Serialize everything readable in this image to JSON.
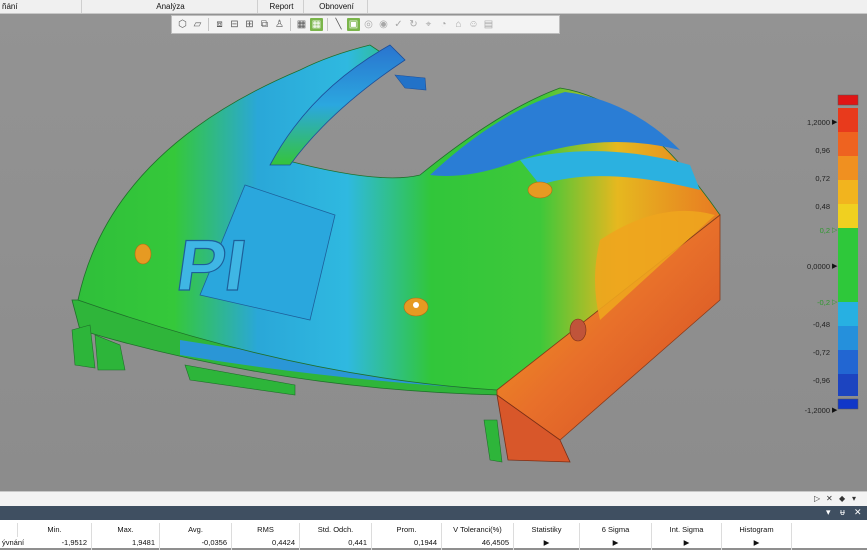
{
  "menubar": {
    "items": [
      "ñání",
      "Analýza",
      "Report",
      "Obnovení"
    ]
  },
  "toolbar": {
    "icons": [
      "sphere-icon",
      "cube-icon",
      "cube-box-icon",
      "front-view-icon",
      "side-view-icon",
      "copy-view-icon",
      "figure-icon",
      "grid-icon",
      "grid-active-icon",
      "line-tool-icon",
      "plane-fill-icon",
      "target-icon",
      "circle-target-icon",
      "checkmark-icon",
      "rotate-icon",
      "measure-icon",
      "gauge-icon",
      "section-icon",
      "person-icon",
      "ruler-icon"
    ]
  },
  "color_scale": {
    "labels": [
      "1,2000",
      "0,96",
      "0,72",
      "0,48",
      "0,2",
      "0,0000",
      "-0,2",
      "-0,48",
      "-0,72",
      "-0,96",
      "-1,2000"
    ],
    "colors": [
      "#1037c8",
      "#1f63d6",
      "#2588de",
      "#27a7e2",
      "#2ec24f",
      "#32c832",
      "#e8c020",
      "#f0a010",
      "#ee7020",
      "#e84e20",
      "#d62020"
    ]
  },
  "panel": {
    "strip_controls": [
      "▷",
      "✕",
      "◆",
      "▾"
    ],
    "bar_controls": [
      "▾",
      "ᵾ",
      "✕"
    ]
  },
  "results": {
    "columns": [
      "Min.",
      "Max.",
      "Avg.",
      "RMS",
      "Std. Odch.",
      "Prom.",
      "V Toleranci(%)",
      "Statistiky",
      "6 Sigma",
      "Int. Sigma",
      "Histogram"
    ],
    "row_label": "ývnání",
    "row_values": [
      "-1,9512",
      "1,9481",
      "-0,0356",
      "0,4424",
      "0,441",
      "0,1944",
      "46,4505",
      "▶",
      "▶",
      "▶",
      "▶"
    ]
  }
}
